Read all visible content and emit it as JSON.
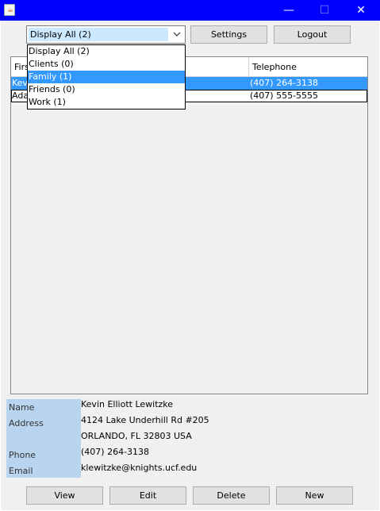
{
  "window": {
    "app_icon": "java-cup-icon",
    "minimize_glyph": "—",
    "maximize_glyph": "☐",
    "close_glyph": "✕"
  },
  "toolbar": {
    "filter_selected": "Display All (2)",
    "settings_label": "Settings",
    "logout_label": "Logout"
  },
  "dropdown": {
    "options": [
      "Display All (2)",
      "Clients (0)",
      "Family (1)",
      "Friends (0)",
      "Work (1)"
    ],
    "highlighted": "Family (1)"
  },
  "table": {
    "columns": [
      "First",
      "Telephone"
    ],
    "rows": [
      {
        "first": "Kevin",
        "telephone": "(407) 264-3138",
        "selected": true
      },
      {
        "first": "Adam",
        "telephone": "(407) 555-5555",
        "selected": false
      }
    ]
  },
  "details": {
    "name_label": "Name",
    "address_label": "Address",
    "phone_label": "Phone",
    "email_label": "Email",
    "name": "Kevin Elliott Lewitzke",
    "address_line1": "4124 Lake Underhill Rd #205",
    "address_line2": "ORLANDO, FL 32803 USA",
    "phone": "(407) 264-3138",
    "email": "klewitzke@knights.ucf.edu"
  },
  "actions": {
    "view_label": "View",
    "edit_label": "Edit",
    "delete_label": "Delete",
    "new_label": "New"
  },
  "colors": {
    "titlebar": "#0000ff",
    "selection": "#3399ff",
    "combo_highlight": "#cce8ff",
    "label_panel": "#b8d4ef"
  }
}
